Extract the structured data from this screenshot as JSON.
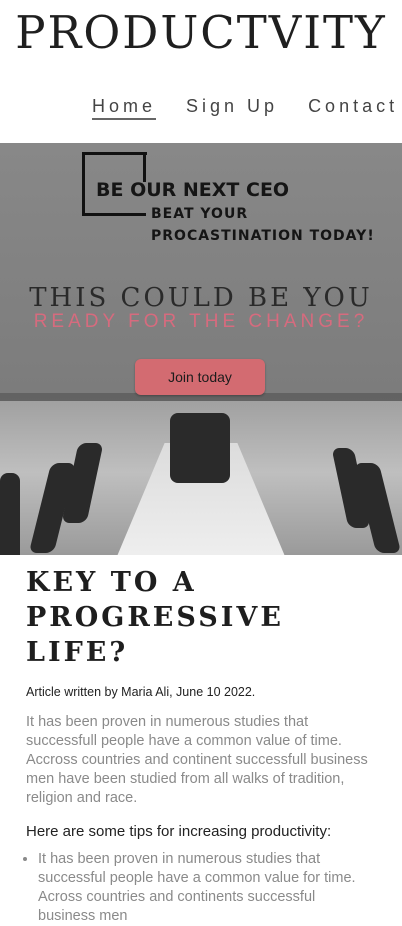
{
  "site": {
    "title": "PRODUCTVITY"
  },
  "nav": {
    "items": [
      "Home",
      "Sign Up",
      "Contact"
    ]
  },
  "hero": {
    "ceo_title": "BE OUR NEXT CEO",
    "ceo_line1": "BEAT YOUR",
    "ceo_line2": "PROCASTINATION TODAY!",
    "headline": "THIS COULD BE YOU",
    "subheadline": "READY FOR THE CHANGE?",
    "button": "Join today",
    "accent_color": "#d36b71"
  },
  "article": {
    "title_line1": "KEY TO A",
    "title_line2": "PROGRESSIVE LIFE?",
    "byline": "Article written by Maria Ali, June 10 2022.",
    "intro": "It has been proven in numerous studies that successfull people have a common value of time. Accross countries and continent successfull business men have been studied from all walks of tradition, religion and race.",
    "tips_heading": "Here are some tips for increasing productivity:",
    "tips": [
      "It has been proven in numerous studies that successful people have a common value for time. Across countries and continents successful business men"
    ]
  }
}
